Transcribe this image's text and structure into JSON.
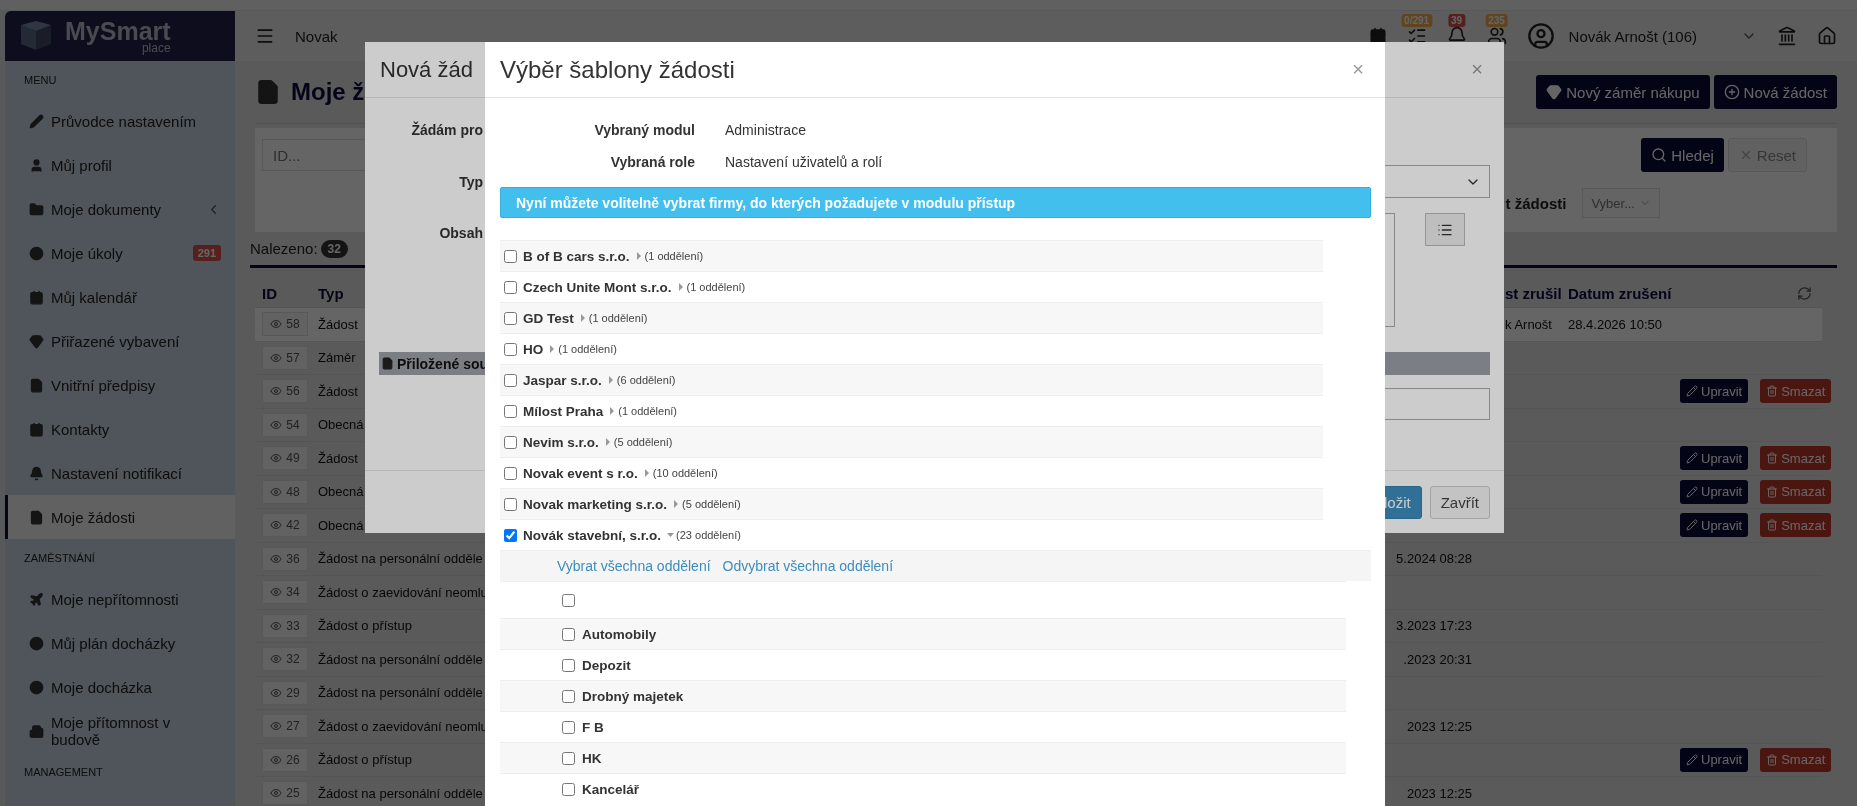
{
  "sidebar": {
    "logo": {
      "title": "MySmart",
      "subtitle": "place"
    },
    "sections": [
      {
        "title": "MENU",
        "items": [
          {
            "label": "Průvodce nastavením",
            "kind": "link",
            "selected": false
          },
          {
            "label": "Můj profil",
            "kind": "link",
            "selected": false
          },
          {
            "label": "Moje dokumenty",
            "kind": "submenu",
            "selected": false
          },
          {
            "label": "Moje úkoly",
            "kind": "link",
            "badge": "291",
            "selected": false
          },
          {
            "label": "Můj kalendář",
            "kind": "link",
            "selected": false
          },
          {
            "label": "Přiřazené vybavení",
            "kind": "link",
            "selected": false
          },
          {
            "label": "Vnitřní předpisy",
            "kind": "link",
            "selected": false
          },
          {
            "label": "Kontakty",
            "kind": "link",
            "selected": false
          },
          {
            "label": "Nastavení notifikací",
            "kind": "link",
            "selected": false
          },
          {
            "label": "Moje žádosti",
            "kind": "link",
            "selected": true
          }
        ]
      },
      {
        "title": "ZAMĚSTNÁNÍ",
        "items": [
          {
            "label": "Moje nepřítomnosti",
            "kind": "link",
            "selected": false
          },
          {
            "label": "Můj plán docházky",
            "kind": "link",
            "selected": false
          },
          {
            "label": "Moje docházka",
            "kind": "link",
            "selected": false
          },
          {
            "label": "Moje přítomnost v budově",
            "kind": "link",
            "selected": false
          }
        ]
      },
      {
        "title": "MANAGEMENT"
      }
    ]
  },
  "header": {
    "workspace": "Novak",
    "user": "Novák Arnošt (106)",
    "indicators": [
      {
        "badge": "0/291",
        "kind": "warning"
      },
      {
        "badge": "39",
        "kind": "danger"
      },
      {
        "badge": "235",
        "kind": "warning"
      }
    ]
  },
  "page": {
    "title": "Moje ž",
    "buttons": [
      "Nový záměr nákupu",
      "Nová žádost"
    ],
    "filters": {
      "id_placeholder": "ID...",
      "search": "Hledej",
      "reset": "Reset",
      "label": "t žádosti",
      "select": "Vyber..."
    },
    "found_label": "Nalezeno:",
    "found_count": "32",
    "table": {
      "columns": [
        "ID",
        "Typ",
        "st zrušil",
        "Datum zrušení"
      ],
      "rows": [
        {
          "id": "58",
          "type": "Žádost",
          "cancelled_by": "k Arnošt",
          "cancelled_at": "28.4.2026 10:50",
          "selected": true
        },
        {
          "id": "57",
          "type": "Záměr",
          "selected": false
        },
        {
          "id": "56",
          "type": "Žádost",
          "edit": "Upravit",
          "delete": "Smazat",
          "selected": false
        },
        {
          "id": "54",
          "type": "Obecná",
          "selected": false
        },
        {
          "id": "49",
          "type": "Žádost",
          "edit": "Upravit",
          "delete": "Smazat",
          "selected": false
        },
        {
          "id": "48",
          "type": "Obecná",
          "edit": "Upravit",
          "delete": "Smazat",
          "selected": false
        },
        {
          "id": "42",
          "type": "Obecná",
          "edit": "Upravit",
          "delete": "Smazat",
          "selected": false
        },
        {
          "id": "36",
          "type": "Žádost na personální odděle",
          "column_3": "5.2024 08:28",
          "selected": false
        },
        {
          "id": "34",
          "type": "Žádost o zaevidování neomlu",
          "selected": false
        },
        {
          "id": "33",
          "type": "Žádost o přístup",
          "column_3": "3.2023 17:23",
          "selected": false
        },
        {
          "id": "32",
          "type": "Žádost na personální odděle",
          "column_3": ".2023 20:31",
          "selected": false
        },
        {
          "id": "29",
          "type": "Žádost na personální odděle",
          "selected": false
        },
        {
          "id": "27",
          "type": "Žádost o zaevidování neomlu",
          "column_3": "2023 12:25",
          "selected": false
        },
        {
          "id": "26",
          "type": "Žádost o přístup",
          "edit": "Upravit",
          "delete": "Smazat",
          "selected": false
        },
        {
          "id": "25",
          "type": "Žádost na personální odděle",
          "column_3": "2023 12:25",
          "selected": false
        }
      ]
    }
  },
  "back_dialog": {
    "title": "Nová žád",
    "close": "×",
    "labels": [
      "Žádám pro",
      "Typ",
      "Obsah"
    ],
    "attachments": "Přiložené sou",
    "save": "ložit",
    "cancel": "Zavřít"
  },
  "dialog": {
    "title": "Výběr šablony žádosti",
    "close": "×",
    "fields": [
      {
        "label": "Vybraný modul",
        "value": "Administrace"
      },
      {
        "label": "Vybraná role",
        "value": "Nastavení uživatelů a rolí"
      }
    ],
    "notice": "Nyní můžete volitelně vybrat firmy, do kterých požadujete v modulu přístup",
    "companies": [
      {
        "name": "B of B cars s.r.o.",
        "count": "(1 oddělení)",
        "checked": false,
        "expanded": false
      },
      {
        "name": "Czech Unite Mont s.r.o.",
        "count": "(1 oddělení)",
        "checked": false,
        "expanded": false
      },
      {
        "name": "GD Test",
        "count": "(1 oddělení)",
        "checked": false,
        "expanded": false
      },
      {
        "name": "HO",
        "count": "(1 oddělení)",
        "checked": false,
        "expanded": false
      },
      {
        "name": "Jaspar s.r.o.",
        "count": "(6 oddělení)",
        "checked": false,
        "expanded": false
      },
      {
        "name": "Mílost Praha",
        "count": "(1 oddělení)",
        "checked": false,
        "expanded": false
      },
      {
        "name": "Nevim s.r.o.",
        "count": "(5 oddělení)",
        "checked": false,
        "expanded": false
      },
      {
        "name": "Novak event s r.o.",
        "count": "(10 oddělení)",
        "checked": false,
        "expanded": false
      },
      {
        "name": "Novak marketing s.r.o.",
        "count": "(5 oddělení)",
        "checked": false,
        "expanded": false
      },
      {
        "name": "Novák stavební, s.r.o.",
        "count": "(23 oddělení)",
        "checked": true,
        "expanded": true,
        "select_all": "Vybrat všechna oddělení",
        "deselect_all": "Odvybrat všechna oddělení",
        "departments": [
          {
            "checked": false
          },
          {
            "name": "Automobily",
            "checked": false
          },
          {
            "name": "Depozit",
            "checked": false
          },
          {
            "name": "Drobný majetek",
            "checked": false
          },
          {
            "name": "F B",
            "checked": false
          },
          {
            "name": "HK",
            "checked": false
          },
          {
            "name": "Kancelář",
            "checked": false
          }
        ]
      }
    ]
  }
}
